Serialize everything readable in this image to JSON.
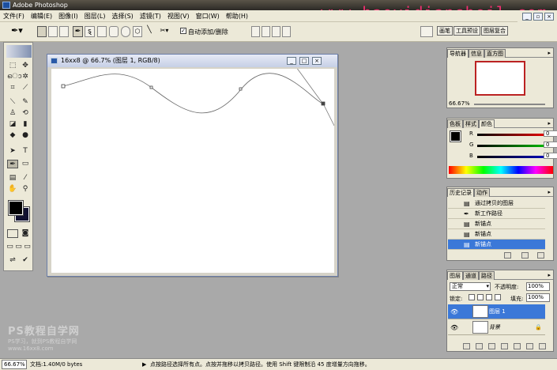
{
  "app": {
    "title": "Adobe Photoshop",
    "watermark": "www.haoyidianshejl.com"
  },
  "menu": [
    "文件(F)",
    "编辑(E)",
    "图像(I)",
    "图层(L)",
    "选择(S)",
    "滤镜(T)",
    "视图(V)",
    "窗口(W)",
    "帮助(H)"
  ],
  "options": {
    "auto_add_delete": "自动添加/删除",
    "auto_add_checked": "✓"
  },
  "dock_tabs": [
    "画笔",
    "工具预设",
    "图层复合"
  ],
  "document": {
    "title": "16xx8 @ 66.7% (图层 1, RGB/8)",
    "min": "_",
    "max": "□",
    "close": "×"
  },
  "navigator": {
    "tabs": [
      "导航器",
      "信息",
      "直方图"
    ],
    "zoom": "66.67%"
  },
  "color": {
    "tabs": [
      "色板",
      "样式",
      "颜色"
    ],
    "channels": [
      {
        "label": "R",
        "value": "0",
        "color": "#c00000"
      },
      {
        "label": "G",
        "value": "0",
        "color": "#00a000"
      },
      {
        "label": "B",
        "value": "0",
        "color": "#0000c0"
      }
    ]
  },
  "history": {
    "tabs": [
      "历史记录",
      "动作"
    ],
    "items": [
      "通过拷贝的图层",
      "新工作路径",
      "新锚点",
      "新锚点",
      "新锚点"
    ]
  },
  "layers": {
    "tabs": [
      "图层",
      "通道",
      "路径"
    ],
    "blend_mode": "正常",
    "opacity_label": "不透明度:",
    "opacity": "100%",
    "lock_label": "锁定:",
    "fill_label": "填充:",
    "fill": "100%",
    "items": [
      {
        "name": "图层 1"
      },
      {
        "name": "背景"
      }
    ]
  },
  "status": {
    "zoom": "66.67%",
    "doc": "文档:1.40M/0 bytes",
    "hint": "点按路径选择所有点。点按并拖移以拷贝路径。使用 Shift 键限制沿 45 度增量方向拖移。"
  },
  "watermark2": {
    "line1": "PS教程自学网",
    "line2": "PS学习，就到PS教程自学网",
    "line3": "www.16xx8.com"
  }
}
